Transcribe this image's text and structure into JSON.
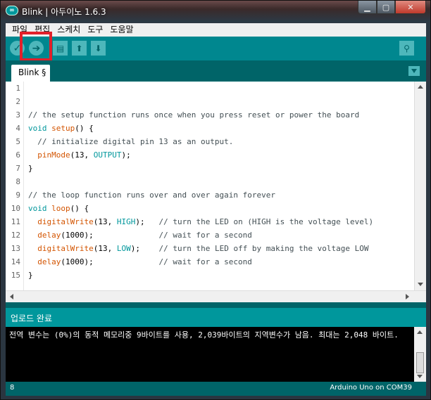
{
  "window": {
    "title": "Blink | 아두이노 1.6.3",
    "app_icon": "arduino-logo",
    "controls": [
      "minimize",
      "maximize",
      "close"
    ]
  },
  "menubar": {
    "items": [
      "파일",
      "편집",
      "스케치",
      "도구",
      "도움말"
    ]
  },
  "toolbar": {
    "buttons": [
      {
        "name": "verify",
        "icon": "check-icon",
        "glyph": "✓"
      },
      {
        "name": "upload",
        "icon": "arrow-right-icon",
        "glyph": "➔"
      },
      {
        "name": "new",
        "icon": "new-document-icon",
        "glyph": "▤"
      },
      {
        "name": "open",
        "icon": "arrow-up-icon",
        "glyph": "⬆"
      },
      {
        "name": "save",
        "icon": "arrow-down-icon",
        "glyph": "⬇"
      },
      {
        "name": "serial-monitor",
        "icon": "magnifier-icon",
        "glyph": "⚲"
      }
    ],
    "highlight_color": "#e2202a"
  },
  "tab": {
    "label": "Blink §"
  },
  "editor": {
    "lines": [
      {
        "no": "1",
        "text": ""
      },
      {
        "no": "2",
        "text": ""
      },
      {
        "no": "3",
        "text": "// the setup function runs once when you press reset or power the board"
      },
      {
        "no": "4",
        "text": "void setup() {"
      },
      {
        "no": "5",
        "text": "  // initialize digital pin 13 as an output."
      },
      {
        "no": "6",
        "text": "  pinMode(13, OUTPUT);"
      },
      {
        "no": "7",
        "text": "}"
      },
      {
        "no": "8",
        "text": ""
      },
      {
        "no": "9",
        "text": "// the loop function runs over and over again forever"
      },
      {
        "no": "10",
        "text": "void loop() {"
      },
      {
        "no": "11",
        "text": "  digitalWrite(13, HIGH);   // turn the LED on (HIGH is the voltage level)"
      },
      {
        "no": "12",
        "text": "  delay(1000);              // wait for a second"
      },
      {
        "no": "13",
        "text": "  digitalWrite(13, LOW);    // turn the LED off by making the voltage LOW"
      },
      {
        "no": "14",
        "text": "  delay(1000);              // wait for a second"
      },
      {
        "no": "15",
        "text": "}"
      }
    ]
  },
  "status": {
    "message": "업로드 완료"
  },
  "console": {
    "output": "전역 변수는 (0%)의 동적 메모리중 9바이트를 사용, 2,039바이트의 지역변수가 남음. 최대는 2,048 바이트."
  },
  "footer": {
    "line": "8",
    "board": "Arduino Uno on COM39"
  },
  "colors": {
    "teal": "#00979c",
    "dark_teal": "#006468",
    "orange": "#d35400"
  }
}
